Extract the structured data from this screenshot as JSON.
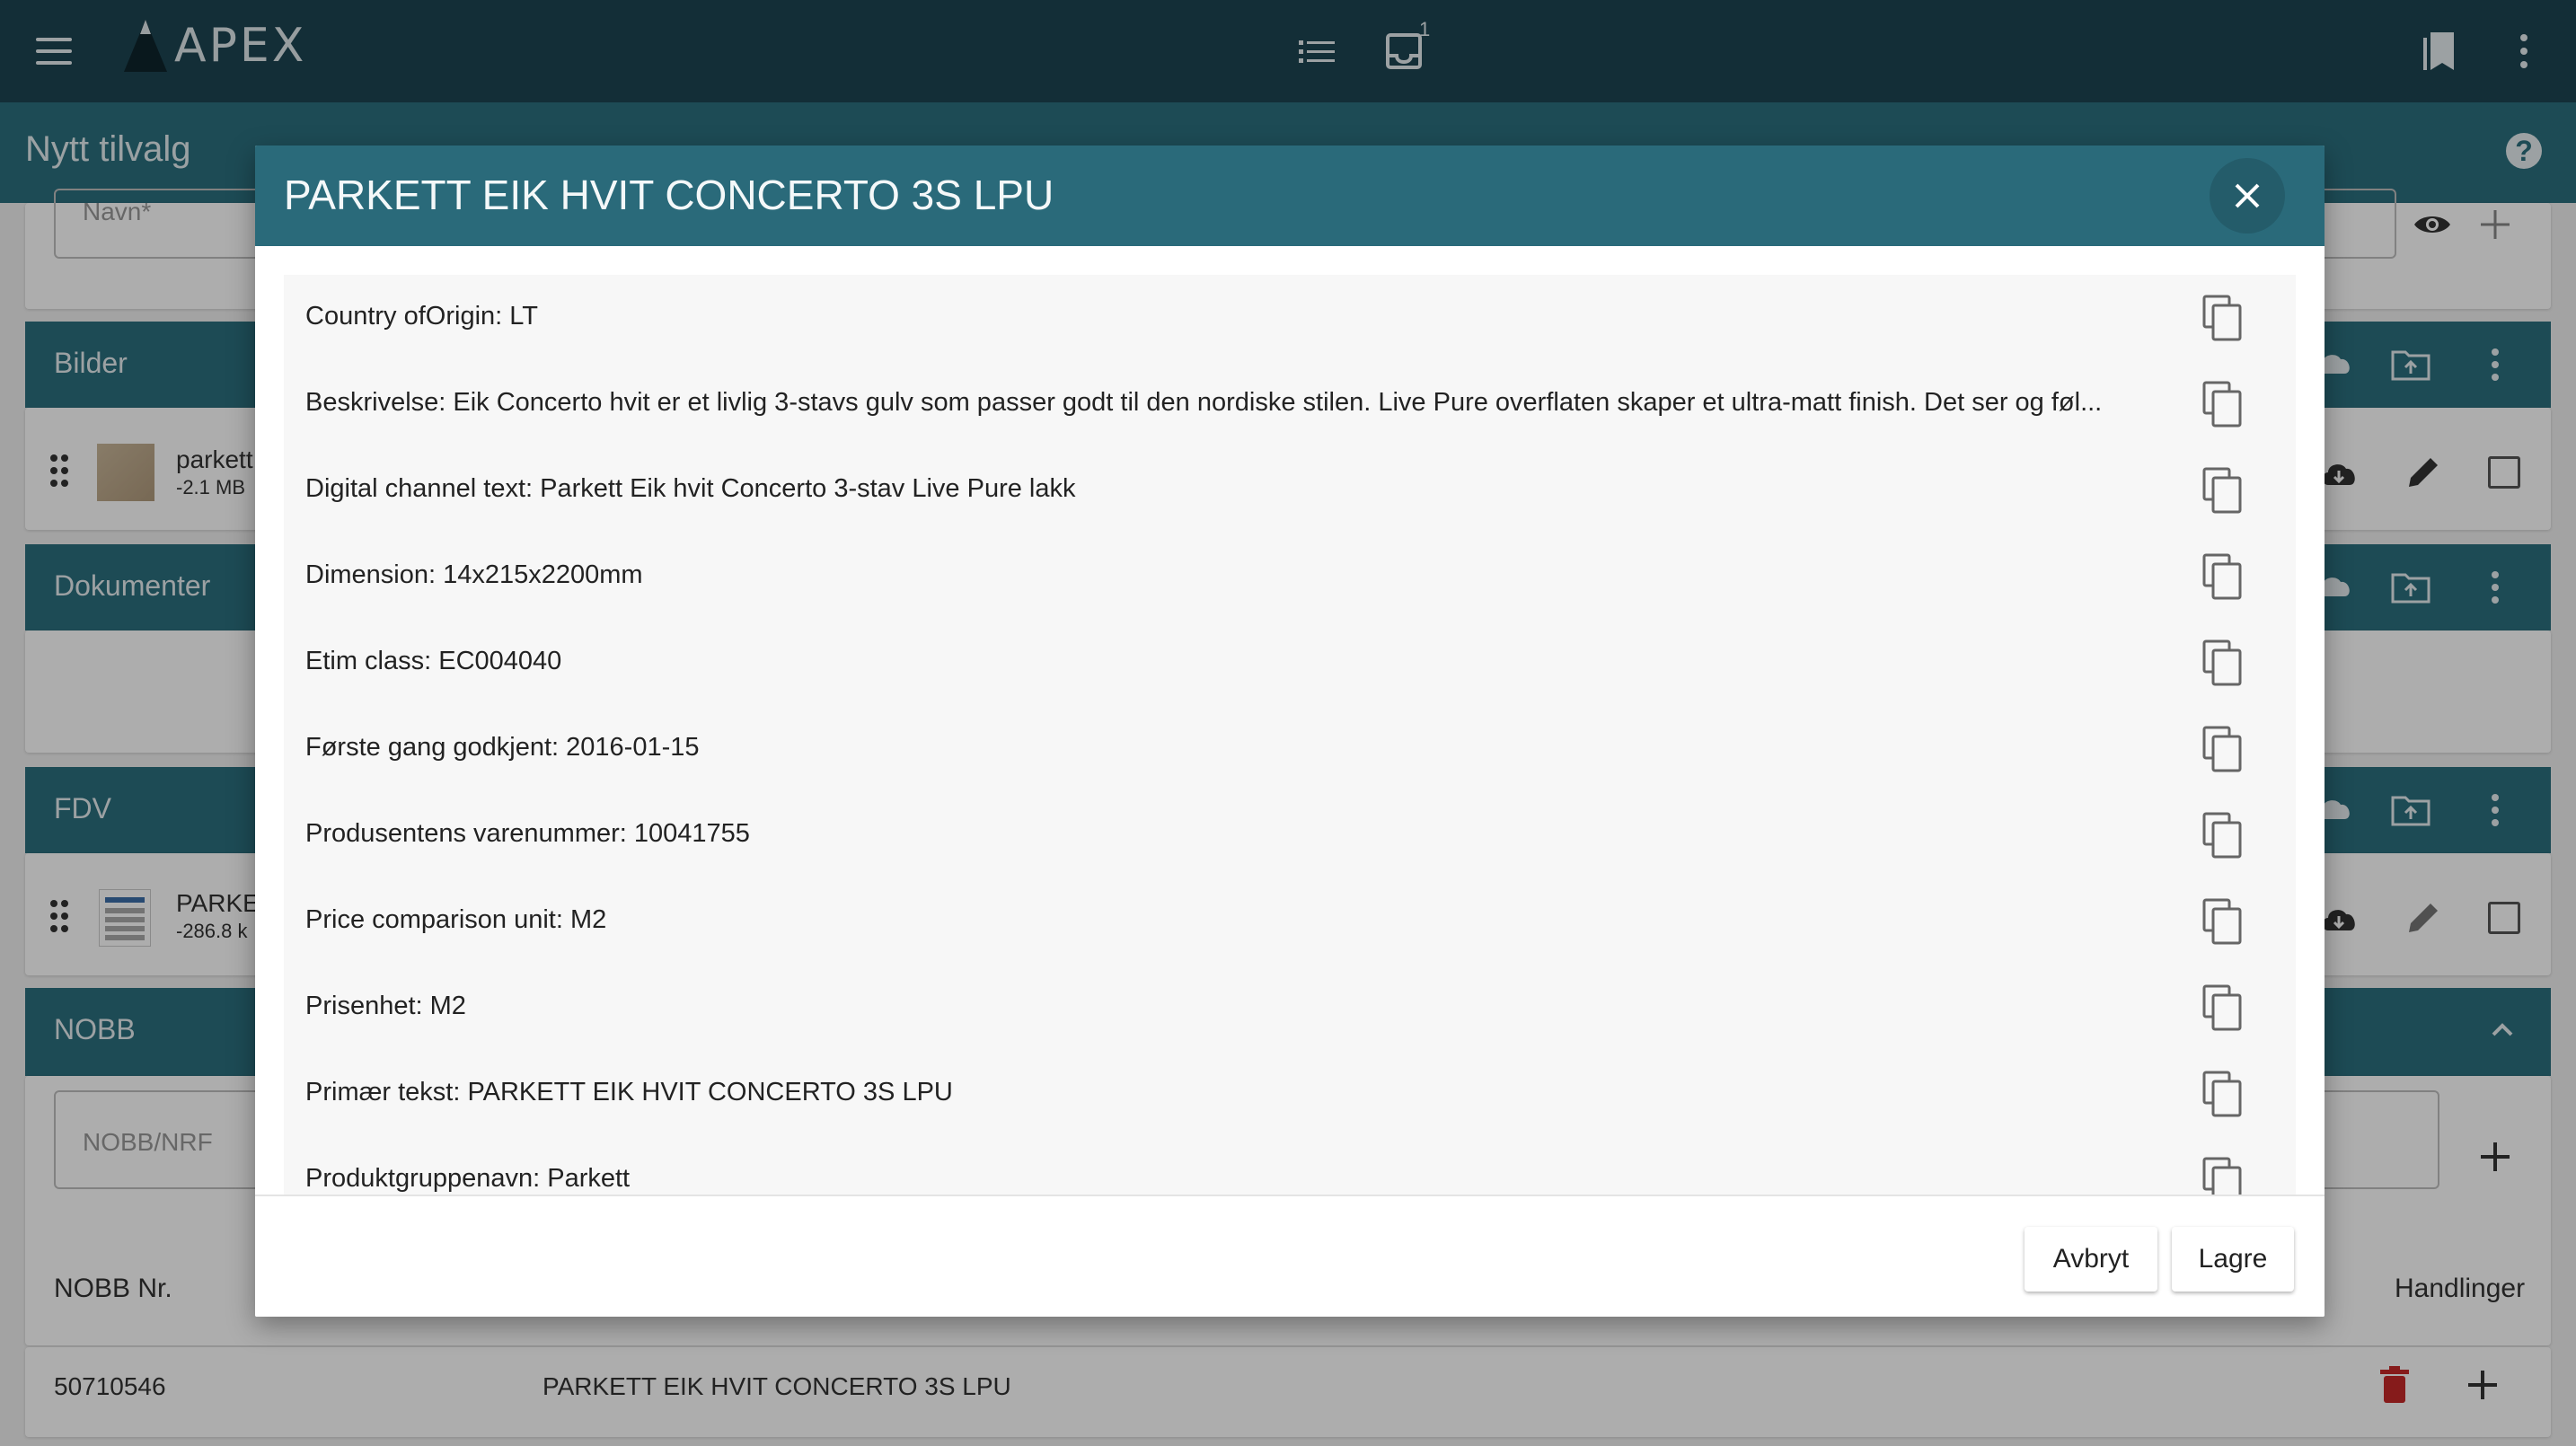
{
  "app": {
    "logo_text": "APEX",
    "inbox_count": "1",
    "page_title": "Nytt tilvalg"
  },
  "background": {
    "name_placeholder": "Navn*",
    "sections": {
      "bilder": "Bilder",
      "dokumenter": "Dokumenter",
      "fdv": "FDV",
      "nobb": "NOBB"
    },
    "bilder_file": {
      "name": "parkett",
      "size": "-2.1 MB"
    },
    "fdv_file": {
      "name": "PARKET",
      "size": "-286.8 k"
    },
    "nobb_placeholder": "NOBB/NRF",
    "table": {
      "col_nobb": "NOBB Nr.",
      "col_actions": "Handlinger",
      "row": {
        "nobb": "50710546",
        "name": "PARKETT EIK HVIT CONCERTO 3S LPU"
      }
    }
  },
  "dialog": {
    "title": "PARKETT EIK HVIT CONCERTO 3S LPU",
    "attributes": [
      "Country ofOrigin: LT",
      "Beskrivelse: Eik Concerto hvit er et livlig 3-stavs gulv som passer godt til den nordiske stilen. Live Pure overflaten skaper et ultra-matt finish. Det ser og føl...",
      "Digital channel text: Parkett Eik hvit Concerto 3-stav Live Pure lakk",
      "Dimension: 14x215x2200mm",
      "Etim class: EC004040",
      "Første gang godkjent: 2016-01-15",
      "Produsentens varenummer: 10041755",
      "Price comparison unit: M2",
      "Prisenhet: M2",
      "Primær tekst: PARKETT EIK HVIT CONCERTO 3S LPU",
      "Produktgruppenavn: Parkett"
    ],
    "cancel_label": "Avbryt",
    "save_label": "Lagre"
  },
  "colors": {
    "appbar": "#1c4451",
    "accent": "#2c6f7e",
    "dialog_header": "#2a6a7a",
    "delete": "#c62828"
  }
}
